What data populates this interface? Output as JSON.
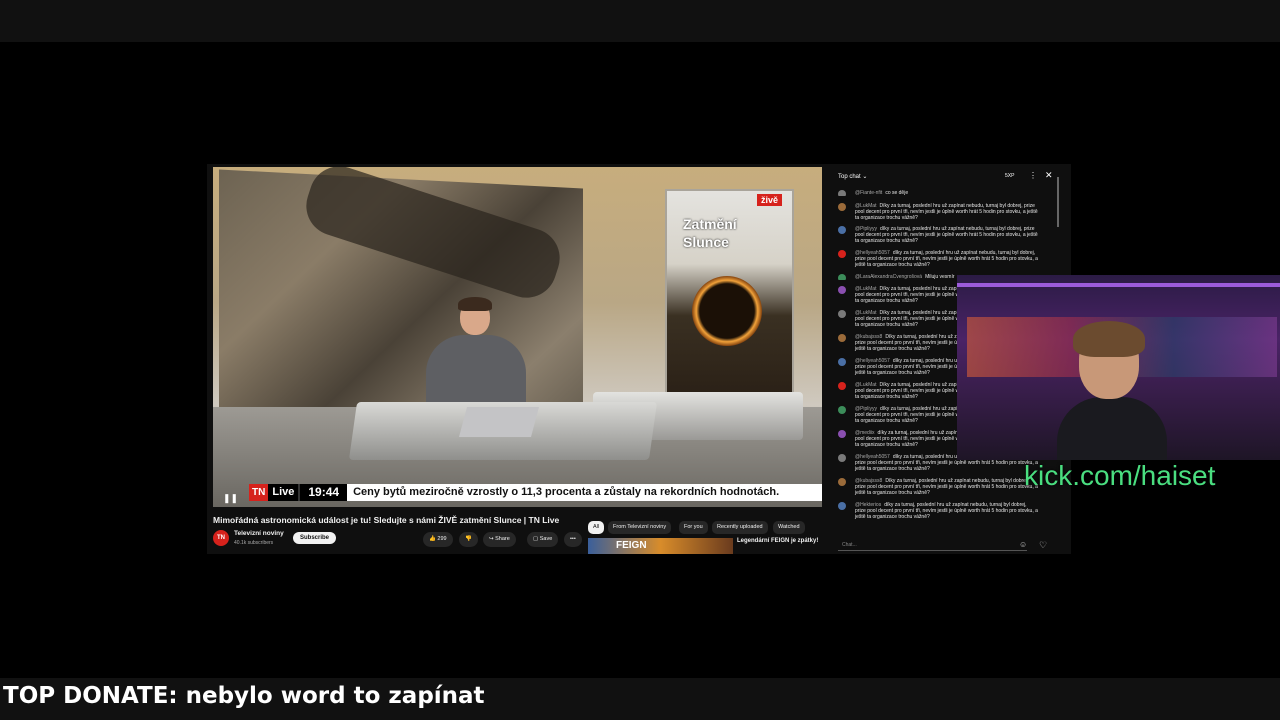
{
  "overlay": {
    "donate_text": "TOP DONATE: nebylo word to zapínat",
    "kick_link": "kick.com/haiset"
  },
  "video": {
    "poster_line1": "Zatmění",
    "poster_line2": "Slunce",
    "live_badge": "živě",
    "tn_logo": "TN",
    "live_label": "Live",
    "clock": "19:44",
    "ticker": "Ceny bytů meziročně vzrostly o 11,3 procenta a zůstaly na rekordních hodnotách.",
    "title": "Mimořádná astronomická událost je tu! Sledujte s námi ŽIVĚ zatmění Slunce | TN Live",
    "channel_name": "Televizní noviny",
    "channel_avatar_text": "TN",
    "channel_subs": "40.1k subscribers",
    "subscribe_label": "Subscribe",
    "like_count": "299",
    "share_label": "Share",
    "save_label": "Save",
    "more_label": "•••"
  },
  "recommendations": {
    "filters": [
      "All",
      "From Televizní noviny",
      "For you",
      "Recently uploaded",
      "Watched"
    ],
    "active_filter": "All",
    "item_thumb_text": "FEIGN",
    "item_title": "Legendární FEIGN je zpátky!"
  },
  "chat": {
    "header": "Top chat",
    "score": "5XP",
    "input_placeholder": "Chat...",
    "messages": [
      {
        "user": "@Fiante-nfit",
        "text": "co se děje"
      },
      {
        "user": "@LukMat",
        "text": "Díky za turnaj, poslední hru už zapínat nebudu, turnaj byl dobrej, prize pool decent pro první tři, nevím jestli je úplně worth hrát 5 hodin pro stovku, a ještě ta organizace trochu vážně?"
      },
      {
        "user": "@Pipliyyy",
        "text": "díky za turnaj, poslední hru už zapínat nebudu, turnaj byl dobrej, prize pool decent pro první tři, nevím jestli je úplně worth hrát 5 hodin pro stovku, a ještě ta organizace trochu vážně?"
      },
      {
        "user": "@hellyeah5057",
        "text": "díky za turnaj, poslední hru už zapínat nebudu, turnaj byl dobrej, prize pool decent pro první tři, nevím jestli je úplně worth hrát 5 hodin pro stovku, a ještě ta organizace trochu vážně?"
      },
      {
        "user": "@LaraAlexandraCvengrošová",
        "text": "Miluju vesmír"
      },
      {
        "user": "@LukMat",
        "text": "Díky za turnaj, poslední hru už zapínat nebudu, turnaj byl dobrej, prize pool decent pro první tři, nevím jestli je úplně worth hrát 5 hodin pro stovku, a ještě ta organizace trochu vážně?"
      },
      {
        "user": "@LukMat",
        "text": "Díky za turnaj, poslední hru už zapínat nebudu, turnaj byl dobrej, prize pool decent pro první tři, nevím jestli je úplně worth hrát 5 hodin pro stovku, a ještě ta organizace trochu vážně?"
      },
      {
        "user": "@kubajsss8",
        "text": "Díky za turnaj, poslední hru už zapínat nebudu, turnaj byl dobrej, prize pool decent pro první tři, nevím jestli je úplně worth hrát 5 hodin pro stovku, a ještě ta organizace trochu vážně?"
      },
      {
        "user": "@hellyeah5057",
        "text": "díky za turnaj, poslední hru už zapínat nebudu, turnaj byl dobrej, prize pool decent pro první tři, nevím jestli je úplně worth hrát 5 hodin pro stovku, a ještě ta organizace trochu vážně?"
      },
      {
        "user": "@LukMat",
        "text": "Díky za turnaj, poslední hru už zapínat nebudu, turnaj byl dobrej, prize pool decent pro první tři, nevím jestli je úplně worth hrát 5 hodin pro stovku, a ještě ta organizace trochu vážně?"
      },
      {
        "user": "@Pipliyyy",
        "text": "díky za turnaj, poslední hru už zapínat nebudu, turnaj byl dobrej, prize pool decent pro první tři, nevím jestli je úplně worth hrát 5 hodin pro stovku, a ještě ta organizace trochu vážně?"
      },
      {
        "user": "@mediix",
        "text": "díky za turnaj, poslední hru už zapínat nebudu, turnaj byl dobrej, prize pool decent pro první tři, nevím jestli je úplně worth hrát 5 hodin pro stovku, a ještě ta organizace trochu vážně?"
      },
      {
        "user": "@hellyeah5057",
        "text": "díky za turnaj, poslední hru už zapínat nebudu, turnaj byl dobrej, prize pool decent pro první tři, nevím jestli je úplně worth hrát 5 hodin pro stovku, a ještě ta organizace trochu vážně?"
      },
      {
        "user": "@kubajsss8",
        "text": "Díky za turnaj, poslední hru už zapínat nebudu, turnaj byl dobrej, prize pool decent pro první tři, nevím jestli je úplně worth hrát 5 hodin pro stovku, a ještě ta organizace trochu vážně?"
      },
      {
        "user": "@Hekterios",
        "text": "díky za turnaj, poslední hru už zapínat nebudu, turnaj byl dobrej, prize pool decent pro první tři, nevím jestli je úplně worth hrát 5 hodin pro stovku, a ještě ta organizace trochu vážně?"
      }
    ]
  },
  "colors": {
    "accent_red": "#d6221c",
    "kick_green": "#4ade80"
  }
}
